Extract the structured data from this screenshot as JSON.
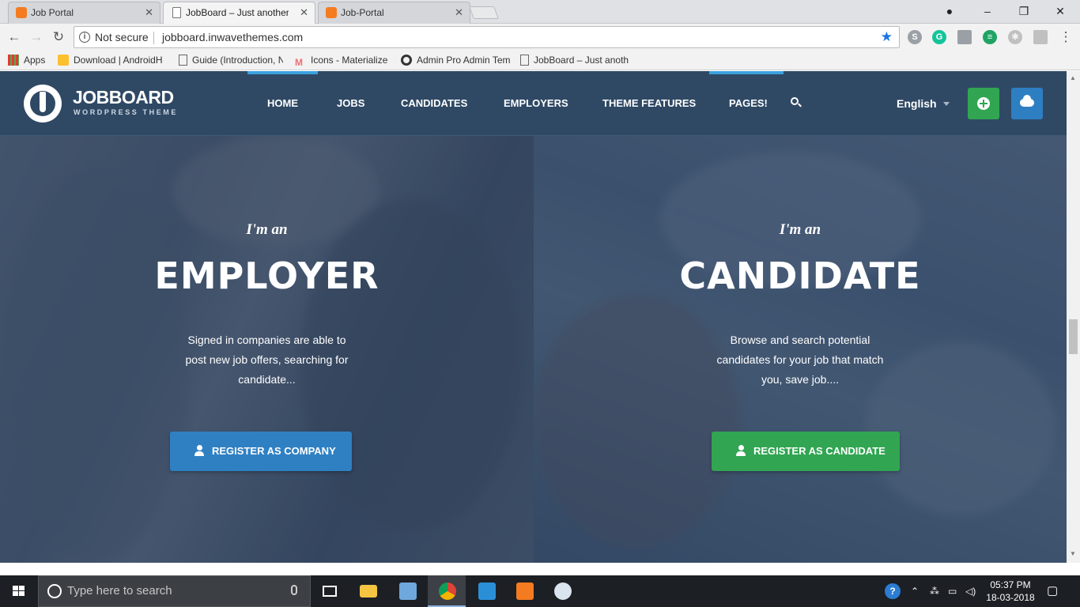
{
  "browser": {
    "tabs": [
      {
        "title": "Job Portal",
        "favicon": "xampp-icon"
      },
      {
        "title": "JobBoard – Just another W",
        "favicon": "page-icon"
      },
      {
        "title": "Job-Portal",
        "favicon": "xampp-icon"
      }
    ],
    "active_tab": 1,
    "security_label": "Not secure",
    "url": "jobboard.inwavethemes.com",
    "bookmarks": [
      {
        "label": "Apps",
        "icon": "apps-grid-icon"
      },
      {
        "label": "Download | AndroidH",
        "icon": "android-icon"
      },
      {
        "label": "Guide (Introduction, N",
        "icon": "page-icon"
      },
      {
        "label": "Icons - Materialize",
        "icon": "materialize-icon"
      },
      {
        "label": "Admin Pro Admin Tem",
        "icon": "adminpro-icon"
      },
      {
        "label": "JobBoard – Just anoth",
        "icon": "page-icon"
      }
    ]
  },
  "site": {
    "logo": {
      "title": "JOBBOARD",
      "subtitle": "WORDPRESS THEME"
    },
    "nav": [
      "HOME",
      "JOBS",
      "CANDIDATES",
      "EMPLOYERS",
      "THEME FEATURES",
      "PAGES!"
    ],
    "language": "English",
    "colors": {
      "header": "#2f4965",
      "primary_blue": "#2f80c3",
      "primary_green": "#31a552"
    },
    "employer": {
      "pre": "I'm an",
      "title": "EMPLOYER",
      "desc": [
        "Signed in companies are able to",
        "post new job offers, searching for",
        "candidate..."
      ],
      "button": "REGISTER AS COMPANY"
    },
    "candidate": {
      "pre": "I'm an",
      "title": "CANDIDATE",
      "desc": [
        "Browse and search potential",
        "candidates for your job that match",
        "you, save job...."
      ],
      "button": "REGISTER AS CANDIDATE"
    }
  },
  "taskbar": {
    "search_placeholder": "Type here to search",
    "time": "05:37 PM",
    "date": "18-03-2018"
  }
}
